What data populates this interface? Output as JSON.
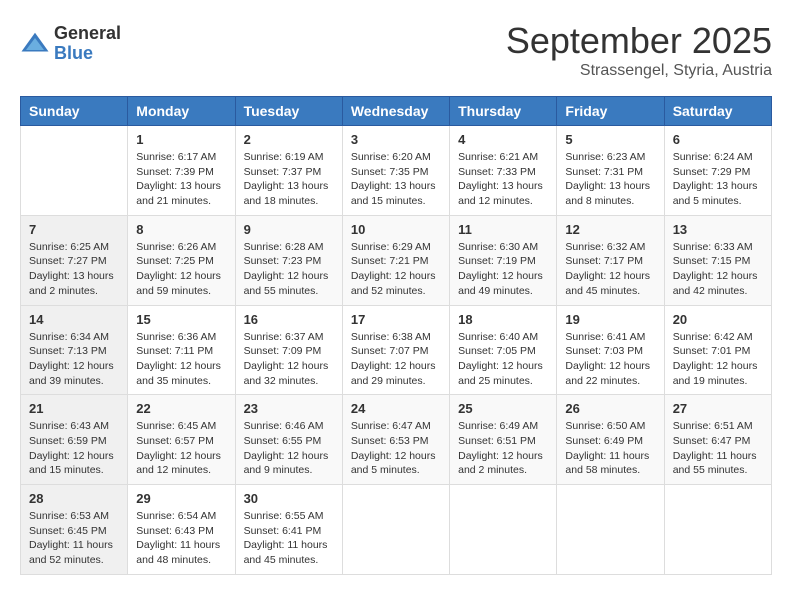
{
  "header": {
    "logo_general": "General",
    "logo_blue": "Blue",
    "month_title": "September 2025",
    "location": "Strassengel, Styria, Austria"
  },
  "days_of_week": [
    "Sunday",
    "Monday",
    "Tuesday",
    "Wednesday",
    "Thursday",
    "Friday",
    "Saturday"
  ],
  "weeks": [
    [
      {
        "day": "",
        "info": ""
      },
      {
        "day": "1",
        "info": "Sunrise: 6:17 AM\nSunset: 7:39 PM\nDaylight: 13 hours\nand 21 minutes."
      },
      {
        "day": "2",
        "info": "Sunrise: 6:19 AM\nSunset: 7:37 PM\nDaylight: 13 hours\nand 18 minutes."
      },
      {
        "day": "3",
        "info": "Sunrise: 6:20 AM\nSunset: 7:35 PM\nDaylight: 13 hours\nand 15 minutes."
      },
      {
        "day": "4",
        "info": "Sunrise: 6:21 AM\nSunset: 7:33 PM\nDaylight: 13 hours\nand 12 minutes."
      },
      {
        "day": "5",
        "info": "Sunrise: 6:23 AM\nSunset: 7:31 PM\nDaylight: 13 hours\nand 8 minutes."
      },
      {
        "day": "6",
        "info": "Sunrise: 6:24 AM\nSunset: 7:29 PM\nDaylight: 13 hours\nand 5 minutes."
      }
    ],
    [
      {
        "day": "7",
        "info": "Sunrise: 6:25 AM\nSunset: 7:27 PM\nDaylight: 13 hours\nand 2 minutes."
      },
      {
        "day": "8",
        "info": "Sunrise: 6:26 AM\nSunset: 7:25 PM\nDaylight: 12 hours\nand 59 minutes."
      },
      {
        "day": "9",
        "info": "Sunrise: 6:28 AM\nSunset: 7:23 PM\nDaylight: 12 hours\nand 55 minutes."
      },
      {
        "day": "10",
        "info": "Sunrise: 6:29 AM\nSunset: 7:21 PM\nDaylight: 12 hours\nand 52 minutes."
      },
      {
        "day": "11",
        "info": "Sunrise: 6:30 AM\nSunset: 7:19 PM\nDaylight: 12 hours\nand 49 minutes."
      },
      {
        "day": "12",
        "info": "Sunrise: 6:32 AM\nSunset: 7:17 PM\nDaylight: 12 hours\nand 45 minutes."
      },
      {
        "day": "13",
        "info": "Sunrise: 6:33 AM\nSunset: 7:15 PM\nDaylight: 12 hours\nand 42 minutes."
      }
    ],
    [
      {
        "day": "14",
        "info": "Sunrise: 6:34 AM\nSunset: 7:13 PM\nDaylight: 12 hours\nand 39 minutes."
      },
      {
        "day": "15",
        "info": "Sunrise: 6:36 AM\nSunset: 7:11 PM\nDaylight: 12 hours\nand 35 minutes."
      },
      {
        "day": "16",
        "info": "Sunrise: 6:37 AM\nSunset: 7:09 PM\nDaylight: 12 hours\nand 32 minutes."
      },
      {
        "day": "17",
        "info": "Sunrise: 6:38 AM\nSunset: 7:07 PM\nDaylight: 12 hours\nand 29 minutes."
      },
      {
        "day": "18",
        "info": "Sunrise: 6:40 AM\nSunset: 7:05 PM\nDaylight: 12 hours\nand 25 minutes."
      },
      {
        "day": "19",
        "info": "Sunrise: 6:41 AM\nSunset: 7:03 PM\nDaylight: 12 hours\nand 22 minutes."
      },
      {
        "day": "20",
        "info": "Sunrise: 6:42 AM\nSunset: 7:01 PM\nDaylight: 12 hours\nand 19 minutes."
      }
    ],
    [
      {
        "day": "21",
        "info": "Sunrise: 6:43 AM\nSunset: 6:59 PM\nDaylight: 12 hours\nand 15 minutes."
      },
      {
        "day": "22",
        "info": "Sunrise: 6:45 AM\nSunset: 6:57 PM\nDaylight: 12 hours\nand 12 minutes."
      },
      {
        "day": "23",
        "info": "Sunrise: 6:46 AM\nSunset: 6:55 PM\nDaylight: 12 hours\nand 9 minutes."
      },
      {
        "day": "24",
        "info": "Sunrise: 6:47 AM\nSunset: 6:53 PM\nDaylight: 12 hours\nand 5 minutes."
      },
      {
        "day": "25",
        "info": "Sunrise: 6:49 AM\nSunset: 6:51 PM\nDaylight: 12 hours\nand 2 minutes."
      },
      {
        "day": "26",
        "info": "Sunrise: 6:50 AM\nSunset: 6:49 PM\nDaylight: 11 hours\nand 58 minutes."
      },
      {
        "day": "27",
        "info": "Sunrise: 6:51 AM\nSunset: 6:47 PM\nDaylight: 11 hours\nand 55 minutes."
      }
    ],
    [
      {
        "day": "28",
        "info": "Sunrise: 6:53 AM\nSunset: 6:45 PM\nDaylight: 11 hours\nand 52 minutes."
      },
      {
        "day": "29",
        "info": "Sunrise: 6:54 AM\nSunset: 6:43 PM\nDaylight: 11 hours\nand 48 minutes."
      },
      {
        "day": "30",
        "info": "Sunrise: 6:55 AM\nSunset: 6:41 PM\nDaylight: 11 hours\nand 45 minutes."
      },
      {
        "day": "",
        "info": ""
      },
      {
        "day": "",
        "info": ""
      },
      {
        "day": "",
        "info": ""
      },
      {
        "day": "",
        "info": ""
      }
    ]
  ]
}
